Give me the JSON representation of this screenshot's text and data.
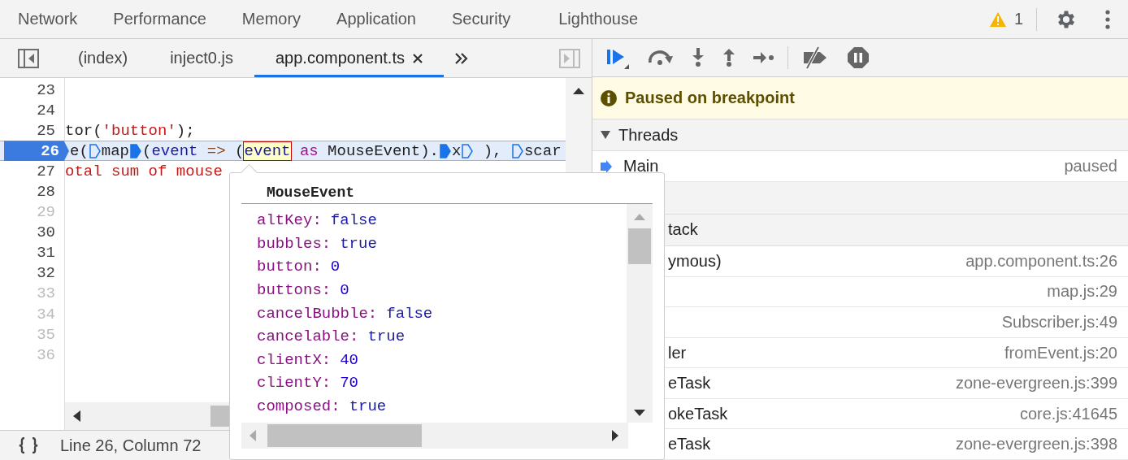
{
  "panel_tabs": [
    {
      "label": "Network",
      "selected": false
    },
    {
      "label": "Performance",
      "selected": false
    },
    {
      "label": "Memory",
      "selected": false
    },
    {
      "label": "Application",
      "selected": false
    },
    {
      "label": "Security",
      "selected": false
    },
    {
      "label": "Lighthouse",
      "selected": false
    }
  ],
  "warning_count": "1",
  "file_tabs": [
    {
      "label": "(index)",
      "selected": false,
      "closable": false
    },
    {
      "label": "inject0.js",
      "selected": false,
      "closable": false
    },
    {
      "label": "app.component.ts",
      "selected": true,
      "closable": true
    }
  ],
  "code_lines": [
    {
      "number": "23",
      "breakable": true,
      "current": false
    },
    {
      "number": "24",
      "breakable": true,
      "current": false
    },
    {
      "number": "25",
      "breakable": true,
      "current": false,
      "tokens": [
        {
          "text": "tor(",
          "kind": "plain"
        },
        {
          "text": "'button'",
          "kind": "string"
        },
        {
          "text": ");",
          "kind": "plain"
        }
      ]
    },
    {
      "number": "26",
      "breakable": true,
      "current": true,
      "tokens": [
        {
          "text": "e(",
          "kind": "plain"
        },
        {
          "kind": "marker",
          "active": false
        },
        {
          "text": "map",
          "kind": "plain"
        },
        {
          "kind": "marker",
          "active": true
        },
        {
          "text": "(",
          "kind": "plain"
        },
        {
          "text": "event",
          "kind": "variable"
        },
        {
          "text": " =>",
          "kind": "operator"
        },
        {
          "text": " (",
          "kind": "plain"
        },
        {
          "text": "event",
          "kind": "hover"
        },
        {
          "text": " as",
          "kind": "keyword"
        },
        {
          "text": " MouseEvent).",
          "kind": "plain"
        },
        {
          "kind": "marker",
          "active": true
        },
        {
          "text": "x",
          "kind": "plain"
        },
        {
          "kind": "marker",
          "active": false
        },
        {
          "text": " ), ",
          "kind": "plain"
        },
        {
          "kind": "marker",
          "active": false
        },
        {
          "text": "scar",
          "kind": "plain"
        }
      ]
    },
    {
      "number": "27",
      "breakable": true,
      "current": false,
      "tokens": [
        {
          "text": "otal sum of mouse",
          "kind": "string"
        }
      ]
    },
    {
      "number": "28",
      "breakable": true,
      "current": false
    },
    {
      "number": "29",
      "breakable": false,
      "current": false
    },
    {
      "number": "30",
      "breakable": true,
      "current": false
    },
    {
      "number": "31",
      "breakable": true,
      "current": false
    },
    {
      "number": "32",
      "breakable": true,
      "current": false
    },
    {
      "number": "33",
      "breakable": false,
      "current": false
    },
    {
      "number": "34",
      "breakable": false,
      "current": false
    },
    {
      "number": "35",
      "breakable": false,
      "current": false
    },
    {
      "number": "36",
      "breakable": false,
      "current": false
    }
  ],
  "status_bar": {
    "position": "Line 26, Column 72"
  },
  "paused_message": "Paused on breakpoint",
  "threads": {
    "title": "Threads",
    "expanded": true,
    "items": [
      {
        "name": "Main",
        "status": "paused",
        "selected": true
      }
    ]
  },
  "call_stack": {
    "title": "tack",
    "frames": [
      {
        "name": "ymous)",
        "location": "app.component.ts:26"
      },
      {
        "location": "map.js:29"
      },
      {
        "location": "Subscriber.js:49"
      },
      {
        "name": "ler",
        "location": "fromEvent.js:20"
      },
      {
        "name": "eTask",
        "location": "zone-evergreen.js:399"
      },
      {
        "name": "okeTask",
        "location": "core.js:41645"
      },
      {
        "name": "eTask",
        "location": "zone-evergreen.js:398"
      }
    ]
  },
  "popover": {
    "title": "MouseEvent",
    "properties": [
      {
        "name": "altKey:",
        "value": "false",
        "kind": "boolean"
      },
      {
        "name": "bubbles:",
        "value": "true",
        "kind": "boolean"
      },
      {
        "name": "button:",
        "value": "0",
        "kind": "number"
      },
      {
        "name": "buttons:",
        "value": "0",
        "kind": "number"
      },
      {
        "name": "cancelBubble:",
        "value": "false",
        "kind": "boolean"
      },
      {
        "name": "cancelable:",
        "value": "true",
        "kind": "boolean"
      },
      {
        "name": "clientX:",
        "value": "40",
        "kind": "number"
      },
      {
        "name": "clientY:",
        "value": "70",
        "kind": "number"
      },
      {
        "name": "composed:",
        "value": "true",
        "kind": "boolean"
      }
    ]
  }
}
